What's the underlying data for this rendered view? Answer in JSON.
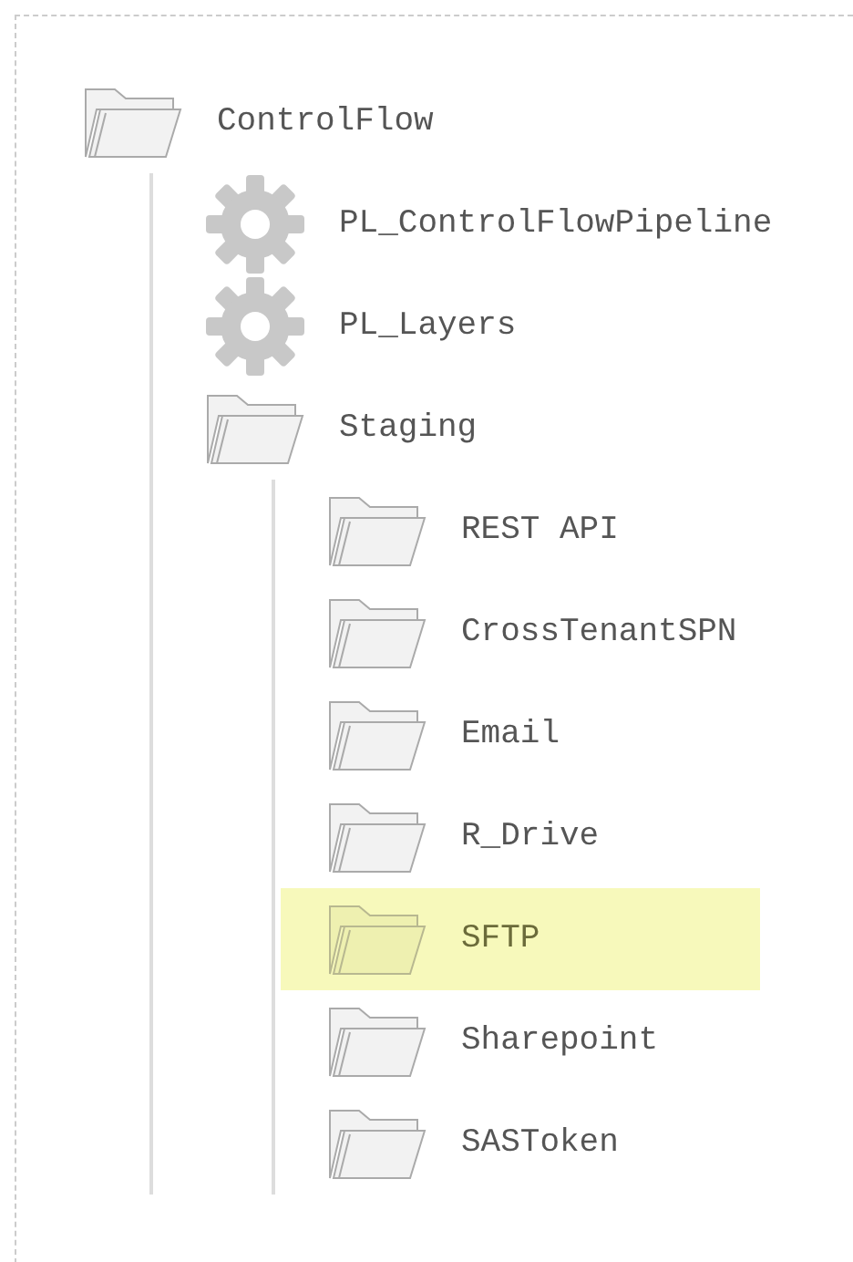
{
  "tree": [
    {
      "label": "ControlFlow",
      "kind": "folder",
      "selected": false,
      "children": [
        {
          "label": "PL_ControlFlowPipeline",
          "kind": "pipeline",
          "selected": false
        },
        {
          "label": "PL_Layers",
          "kind": "pipeline",
          "selected": false
        },
        {
          "label": "Staging",
          "kind": "folder",
          "selected": false,
          "children": [
            {
              "label": "REST API",
              "kind": "folder",
              "selected": false
            },
            {
              "label": "CrossTenantSPN",
              "kind": "folder",
              "selected": false
            },
            {
              "label": "Email",
              "kind": "folder",
              "selected": false
            },
            {
              "label": "R_Drive",
              "kind": "folder",
              "selected": false
            },
            {
              "label": "SFTP",
              "kind": "folder",
              "selected": true
            },
            {
              "label": "Sharepoint",
              "kind": "folder",
              "selected": false
            },
            {
              "label": "SASToken",
              "kind": "folder",
              "selected": false
            }
          ]
        }
      ]
    }
  ]
}
